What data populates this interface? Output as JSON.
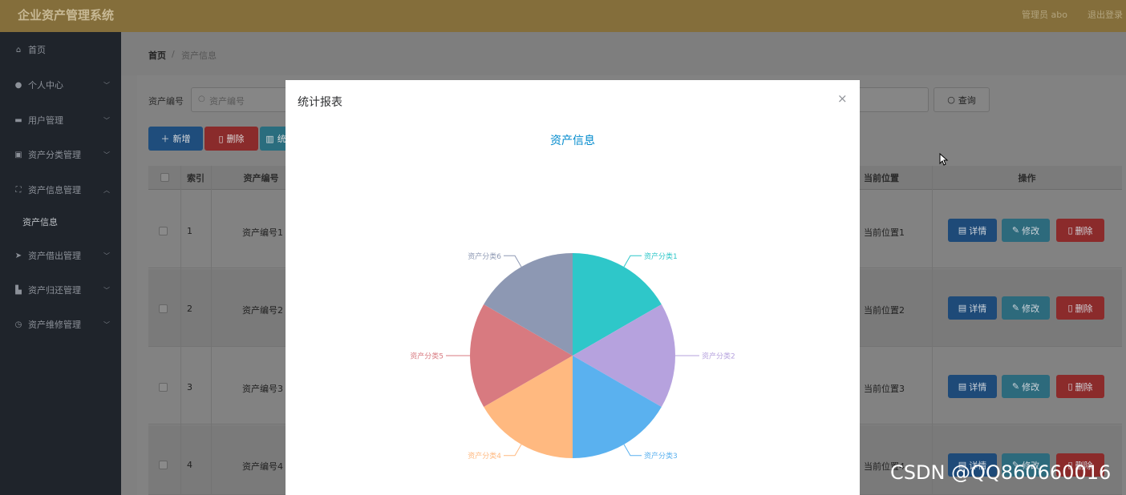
{
  "header": {
    "title": "企业资产管理系统",
    "user": "管理员 abo",
    "logout": "退出登录"
  },
  "sidebar": {
    "items": [
      {
        "label": "首页",
        "icon": "home-icon",
        "glyph": "⌂",
        "expandable": false
      },
      {
        "label": "个人中心",
        "icon": "user-icon",
        "glyph": "●",
        "expandable": true
      },
      {
        "label": "用户管理",
        "icon": "chat-icon",
        "glyph": "▬",
        "expandable": true
      },
      {
        "label": "资产分类管理",
        "icon": "clipboard-icon",
        "glyph": "▣",
        "expandable": true
      },
      {
        "label": "资产信息管理",
        "icon": "fullscreen-icon",
        "glyph": "⛶",
        "expandable": true,
        "open": true
      },
      {
        "label": "资产信息",
        "submenu": true
      },
      {
        "label": "资产借出管理",
        "icon": "send-icon",
        "glyph": "➤",
        "expandable": true
      },
      {
        "label": "资产归还管理",
        "icon": "truck-icon",
        "glyph": "▙",
        "expandable": true
      },
      {
        "label": "资产维修管理",
        "icon": "clock-icon",
        "glyph": "◷",
        "expandable": true
      }
    ]
  },
  "breadcrumb": {
    "home": "首页",
    "separator": "/",
    "current": "资产信息"
  },
  "search": {
    "label": "资产编号",
    "placeholder": "资产编号",
    "query_button": "查询"
  },
  "toolbar": {
    "add": "新增",
    "delete": "删除",
    "stat": "统"
  },
  "table": {
    "headers": {
      "index": "索引",
      "code": "资产编号",
      "location": "当前位置",
      "actions": "操作"
    },
    "rows": [
      {
        "index": "1",
        "code": "资产编号1",
        "location": "当前位置1"
      },
      {
        "index": "2",
        "code": "资产编号2",
        "location": "当前位置2"
      },
      {
        "index": "3",
        "code": "资产编号3",
        "location": "当前位置3"
      },
      {
        "index": "4",
        "code": "资产编号4",
        "location": "当前位置4"
      }
    ],
    "actions": {
      "detail": "详情",
      "edit": "修改",
      "delete": "删除"
    }
  },
  "modal": {
    "title": "统计报表",
    "close": "×"
  },
  "chart_data": {
    "type": "pie",
    "title": "资产信息",
    "slices": [
      {
        "name": "资产分类1",
        "value": 1,
        "color": "#2ec7c9"
      },
      {
        "name": "资产分类2",
        "value": 1,
        "color": "#b6a2de"
      },
      {
        "name": "资产分类3",
        "value": 1,
        "color": "#5ab1ef"
      },
      {
        "name": "资产分类4",
        "value": 1,
        "color": "#ffb980"
      },
      {
        "name": "资产分类5",
        "value": 1,
        "color": "#d87a80"
      },
      {
        "name": "资产分类6",
        "value": 1,
        "color": "#8d98b3"
      }
    ],
    "title_color": "#008acd",
    "legend": "none"
  },
  "watermark": "CSDN @QQ860660016"
}
